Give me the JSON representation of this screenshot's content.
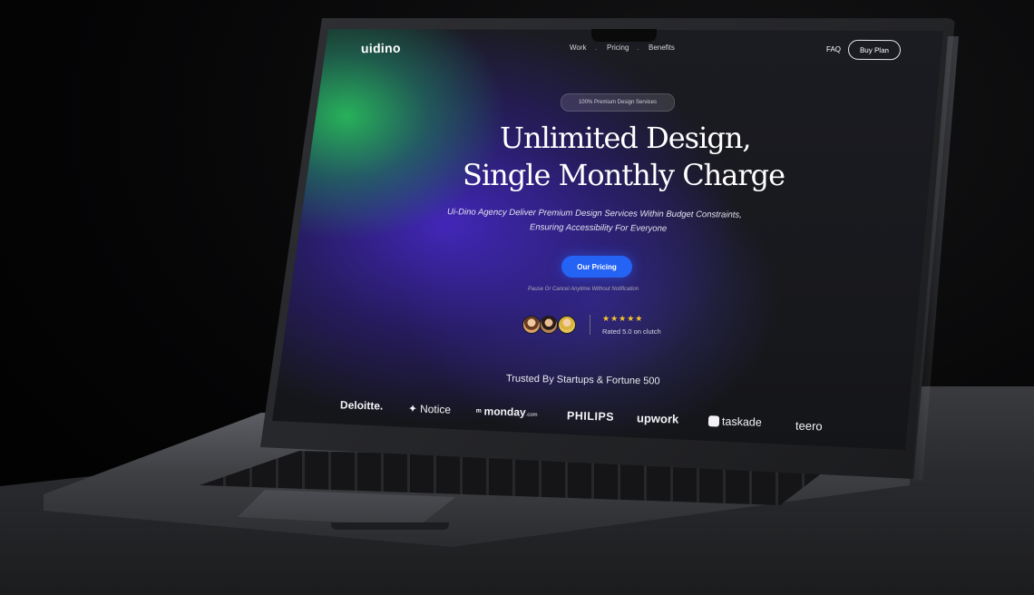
{
  "site": {
    "logo": "uidino",
    "nav": [
      "Work",
      "Pricing",
      "Benefits"
    ],
    "nav_separator": ".",
    "faq": "FAQ",
    "buy_plan": "Buy Plan"
  },
  "hero": {
    "badge": "100% Premium Design Services",
    "headline_line1": "Unlimited Design,",
    "headline_line2": "Single Monthly Charge",
    "subtitle_line1": "Ui-Dino Agency Deliver Premium Design Services Within Budget Constraints,",
    "subtitle_line2": "Ensuring Accessibility For Everyone",
    "cta": "Our Pricing",
    "cta_note": "Pause Or Cancel Anytime Without Notification"
  },
  "rating": {
    "stars": "★★★★★",
    "text": "Rated 5.0 on clutch"
  },
  "trusted": {
    "heading": "Trusted By Startups & Fortune 500",
    "brands": [
      "Deloitte.",
      "Notice",
      "monday",
      "PHILIPS",
      "upwork",
      "taskade",
      "teero"
    ],
    "monday_suffix": ".com"
  },
  "colors": {
    "accent": "#2563f5",
    "star": "#f7c52d",
    "glow_green": "#28b95a",
    "glow_purple": "#4628c8"
  },
  "icons": {
    "notice": "sparkle-icon",
    "monday": "monday-logo-icon",
    "taskade": "taskade-logo-icon"
  }
}
